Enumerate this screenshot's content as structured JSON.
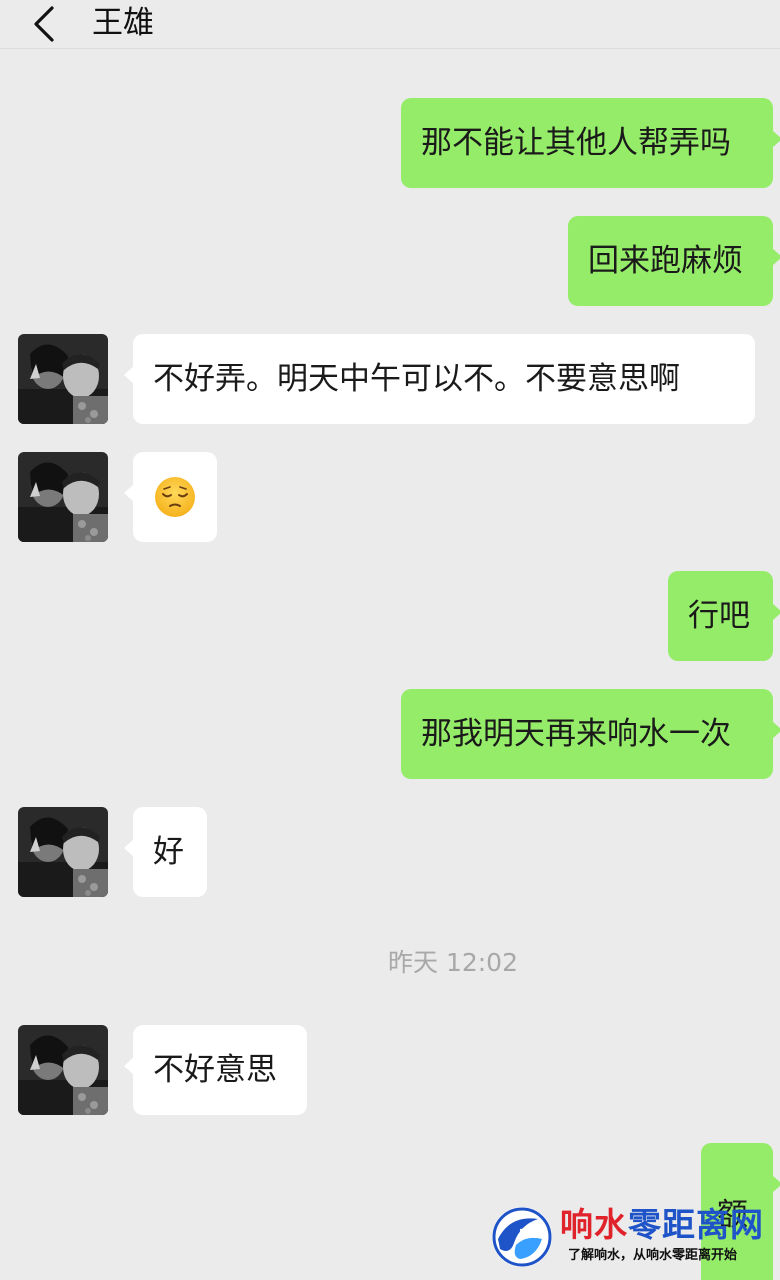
{
  "header": {
    "contact_name": "王雄",
    "back_icon": "chevron-left-icon"
  },
  "messages": [
    {
      "from": "me",
      "text": "那不能让其他人帮弄吗"
    },
    {
      "from": "me",
      "text": "回来跑麻烦"
    },
    {
      "from": "them",
      "text": "不好弄。明天中午可以不。不要意思啊"
    },
    {
      "from": "them",
      "text": "",
      "emoji": "pensive-face-emoji"
    },
    {
      "from": "me",
      "text": "行吧"
    },
    {
      "from": "me",
      "text": "那我明天再来响水一次"
    },
    {
      "from": "them",
      "text": "好"
    },
    {
      "from": "them",
      "text": "不好意思"
    },
    {
      "from": "me",
      "text": "额"
    }
  ],
  "timestamp": "昨天 12:02",
  "colors": {
    "background": "#ebebeb",
    "my_bubble": "#95ec69",
    "their_bubble": "#ffffff",
    "timestamp_text": "#a8a8a8"
  },
  "watermark": {
    "title_red": "响水",
    "title_blue": "零距离网",
    "slogan": "了解响水，从响水零距离开始"
  }
}
